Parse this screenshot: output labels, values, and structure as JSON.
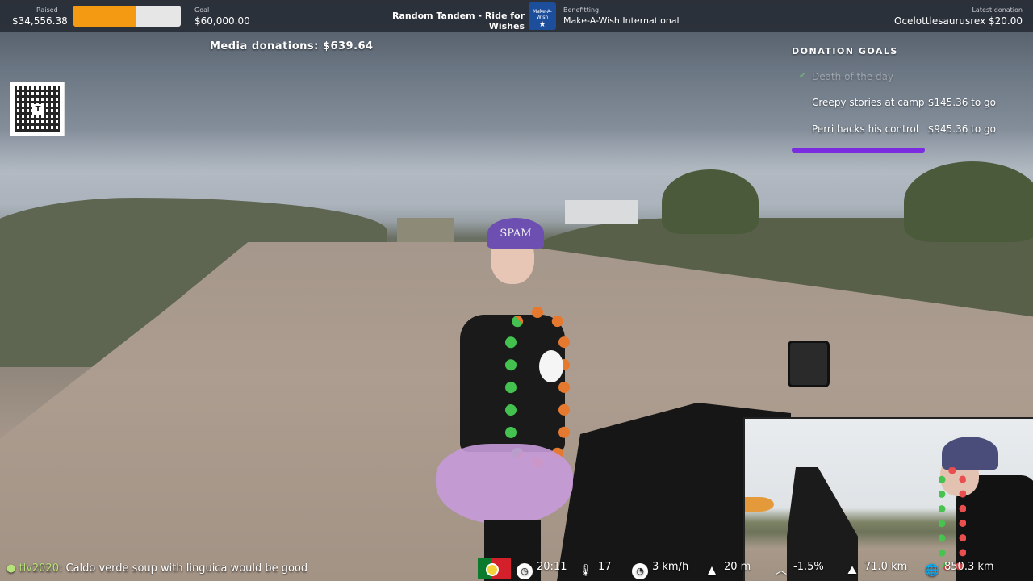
{
  "stream": {
    "raised_label": "Raised",
    "raised_value": "$34,556.38",
    "goal_label": "Goal",
    "goal_value": "$60,000.00",
    "progress_fraction": 0.576,
    "title": "Random Tandem - Ride for Wishes",
    "benefitting_label": "Benefitting",
    "benefitting_org": "Make-A-Wish International",
    "logo_text": "Make-A-Wish",
    "latest_label": "Latest donation",
    "latest_value": "Ocelottlesaurusrex $20.00"
  },
  "media_donations": "Media donations: $639.64",
  "qr_center": "T",
  "donation_goals": {
    "title": "DONATION GOALS",
    "completed": "Death of the day",
    "items": [
      {
        "label": "Creepy stories at camp",
        "amount": "$145.36 to go"
      },
      {
        "label": "Perri hacks his control",
        "amount": "$945.36 to go"
      }
    ]
  },
  "scene": {
    "helmet_text": "SPAM"
  },
  "chat": {
    "user": "tlv2020:",
    "message": "Caldo verde soup with linguica would be good"
  },
  "stats": {
    "time": "20:11",
    "temperature": "17",
    "speed": "3 km/h",
    "altitude": "20 m",
    "grade": "-1.5%",
    "distance_today": "71.0 km",
    "distance_total": "850.3 km"
  },
  "icons": {
    "flag": "portugal-flag-icon",
    "time": "clock-icon",
    "temperature": "thermometer-icon",
    "speed": "speedometer-icon",
    "altitude": "mountain-icon",
    "grade": "chevron-up-icon",
    "distance_today": "road-icon",
    "distance_total": "globe-icon"
  },
  "colors": {
    "progress_fill": "#f39a12",
    "goal_bar": "#7b2ce0",
    "chat_user": "#b7e27a"
  }
}
